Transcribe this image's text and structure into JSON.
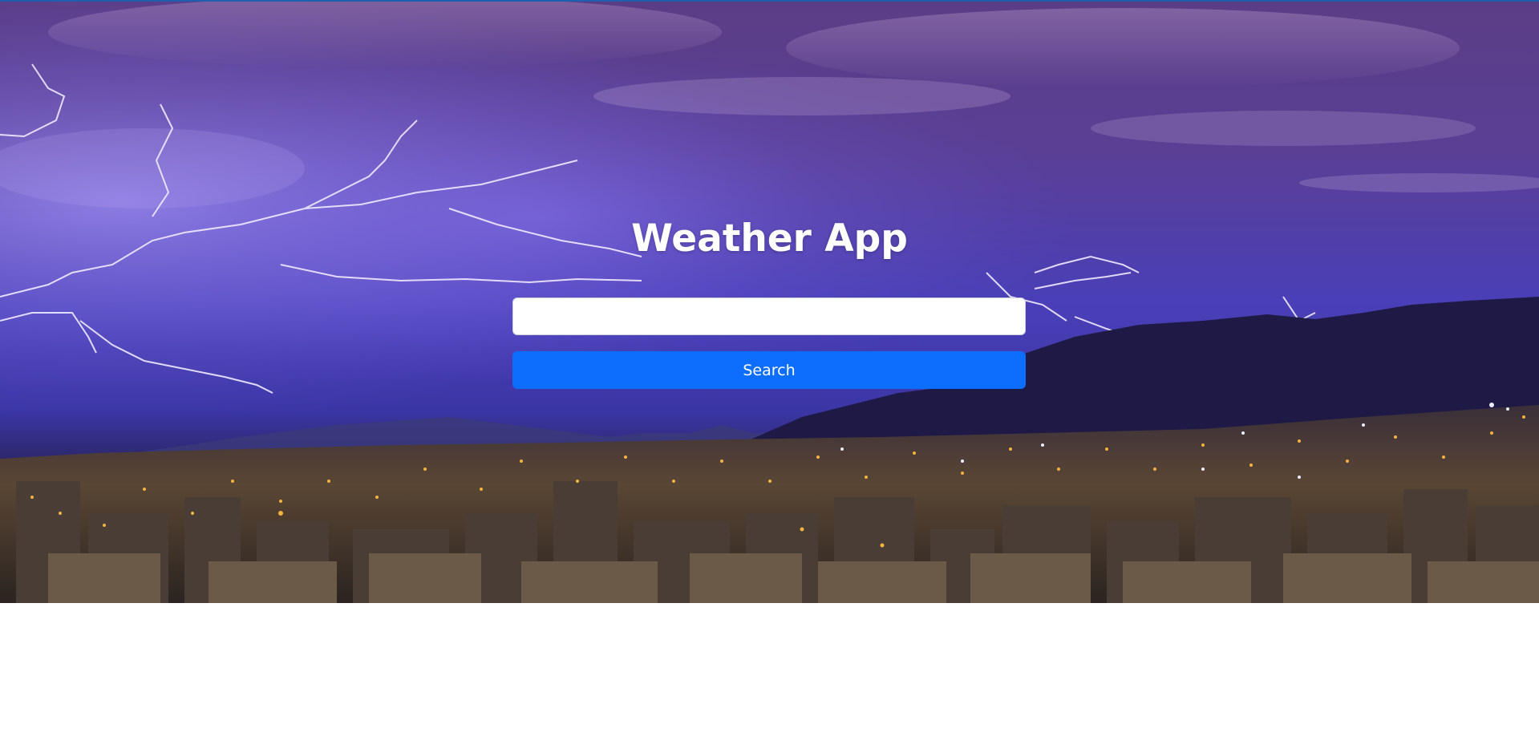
{
  "app": {
    "title": "Weather App"
  },
  "search": {
    "value": "",
    "placeholder": "",
    "button_label": "Search"
  },
  "theme": {
    "accent": "#0d6efd",
    "top_line": "#1f5fae",
    "sky_top": "#5b3d86",
    "sky_mid": "#4a3fb8",
    "mountain": "#1f1a45",
    "city_lights": "#f2b441"
  },
  "icons": {
    "hero_image": "city-lightning-background"
  }
}
